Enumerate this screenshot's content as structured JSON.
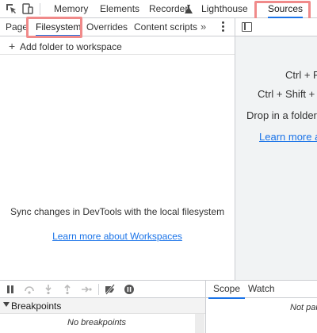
{
  "top_tabs": [
    {
      "label": "Memory"
    },
    {
      "label": "Elements"
    },
    {
      "label": "Recorder"
    },
    {
      "label": "Lighthouse"
    },
    {
      "label": "Sources",
      "active": true
    }
  ],
  "navigator": {
    "tabs": [
      {
        "label": "Page"
      },
      {
        "label": "Filesystem",
        "active": true
      },
      {
        "label": "Overrides"
      },
      {
        "label": "Content scripts"
      }
    ],
    "more": "»",
    "add_folder": "Add folder to workspace",
    "empty_message": "Sync changes in DevTools with the local filesystem",
    "empty_link": "Learn more about Workspaces"
  },
  "editor": {
    "shortcut_1": "Ctrl + P",
    "shortcut_2": "Ctrl + Shift + P",
    "hint": "Drop in a folder t",
    "link": "Learn more a"
  },
  "debugger": {
    "breakpoints_title": "Breakpoints",
    "no_breakpoints": "No breakpoints"
  },
  "scope": {
    "tabs": [
      {
        "label": "Scope",
        "active": true
      },
      {
        "label": "Watch"
      }
    ],
    "status": "Not pau"
  },
  "colors": {
    "accent": "#1a73e8",
    "highlight": "#f08a8a",
    "editor_bg": "#f1f3f4"
  }
}
